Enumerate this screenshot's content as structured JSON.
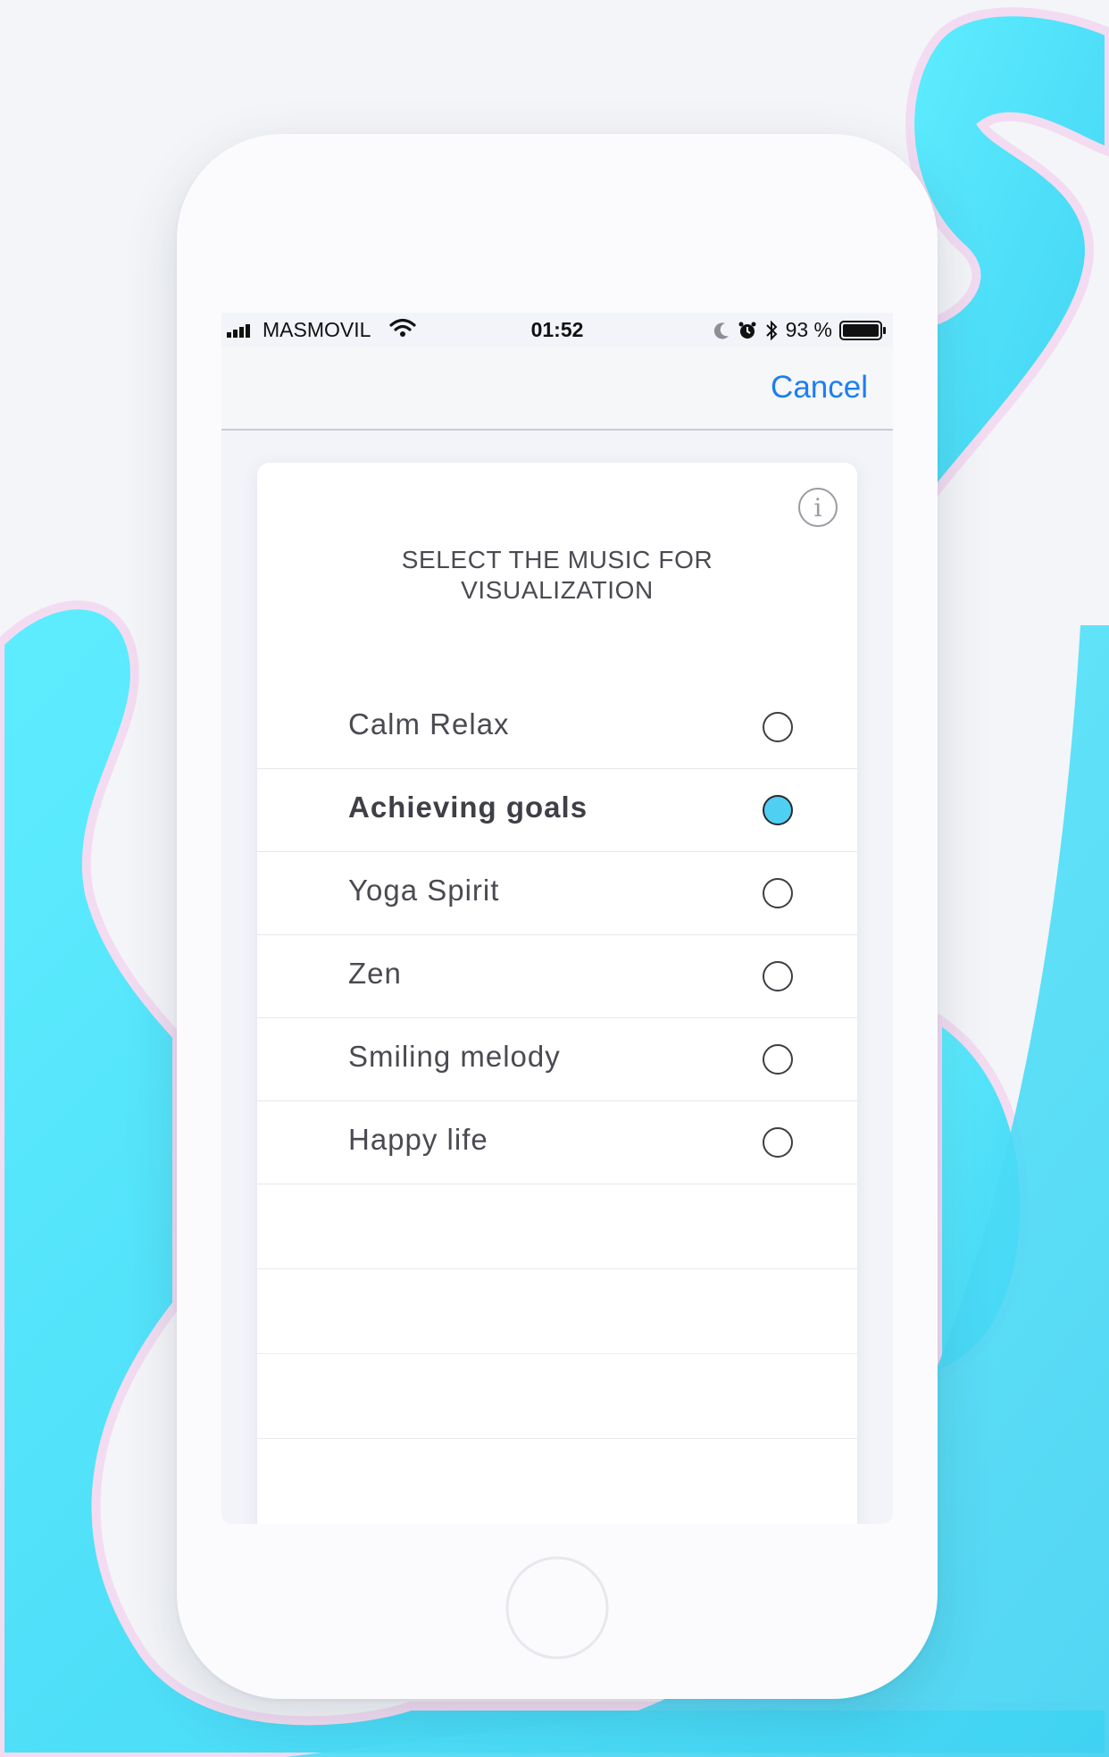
{
  "status_bar": {
    "carrier": "MASMOVIL",
    "time": "01:52",
    "battery": "93 %"
  },
  "nav": {
    "cancel_label": "Cancel"
  },
  "card": {
    "title_line1": "SELECT THE MUSIC FOR",
    "title_line2": "VISUALIZATION",
    "info_icon": "i"
  },
  "tracks": [
    {
      "label": "Calm Relax",
      "selected": false
    },
    {
      "label": "Achieving goals",
      "selected": true
    },
    {
      "label": "Yoga Spirit",
      "selected": false
    },
    {
      "label": "Zen",
      "selected": false
    },
    {
      "label": "Smiling melody",
      "selected": false
    },
    {
      "label": "Happy life",
      "selected": false
    }
  ],
  "colors": {
    "accent": "#1d7ef2",
    "selected_radio": "#4fd0f2",
    "background_blob": "#55e4fb"
  }
}
